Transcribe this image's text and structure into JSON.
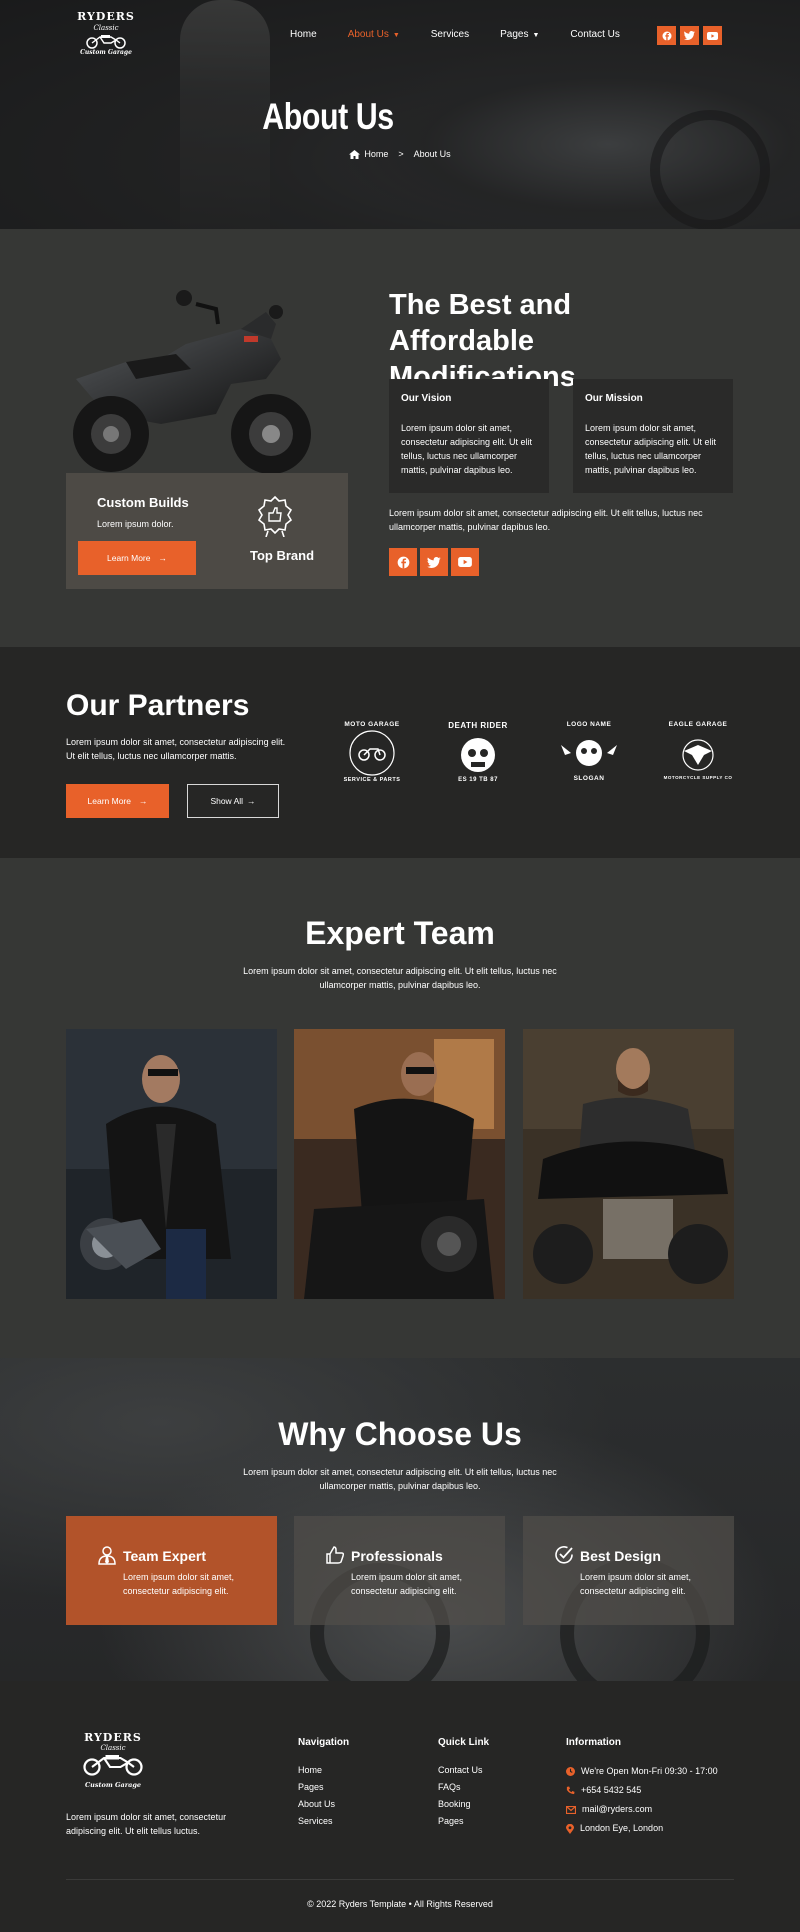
{
  "brand": {
    "name": "RYDERS",
    "sub": "Classic",
    "tag": "Custom Garage"
  },
  "nav": {
    "items": [
      {
        "label": "Home",
        "active": false,
        "caret": false
      },
      {
        "label": "About Us",
        "active": true,
        "caret": true
      },
      {
        "label": "Services",
        "active": false,
        "caret": false
      },
      {
        "label": "Pages",
        "active": false,
        "caret": true
      },
      {
        "label": "Contact Us",
        "active": false,
        "caret": false
      }
    ],
    "social": [
      "facebook-icon",
      "twitter-icon",
      "youtube-icon"
    ]
  },
  "hero": {
    "title": "About Us",
    "breadcrumb_home": "Home",
    "breadcrumb_sep": ">",
    "breadcrumb_current": "About Us"
  },
  "about": {
    "custom_builds_title": "Custom Builds",
    "custom_builds_text": "Lorem ipsum dolor.",
    "learn_more": "Learn More",
    "top_brand": "Top Brand",
    "heading": "The Best and Affordable Modifications",
    "vision_title": "Our Vision",
    "vision_text": "Lorem ipsum dolor sit amet, consectetur adipiscing elit. Ut elit tellus, luctus nec ullamcorper mattis, pulvinar dapibus leo.",
    "mission_title": "Our Mission",
    "mission_text": "Lorem ipsum dolor sit amet, consectetur adipiscing elit. Ut elit tellus, luctus nec ullamcorper mattis, pulvinar dapibus leo.",
    "paragraph": "Lorem ipsum dolor sit amet, consectetur adipiscing elit. Ut elit tellus, luctus nec ullamcorper mattis, pulvinar dapibus leo."
  },
  "partners": {
    "title": "Our Partners",
    "text": "Lorem ipsum dolor sit amet, consectetur adipiscing elit. Ut elit tellus, luctus nec ullamcorper mattis.",
    "learn_more": "Learn More",
    "show_all": "Show All",
    "logos": [
      {
        "top": "MOTO GARAGE",
        "bottom": "SERVICE & PARTS"
      },
      {
        "top": "DEATH RIDER",
        "bottom": "ES 19 TB 87"
      },
      {
        "top": "LOGO NAME",
        "bottom": "SLOGAN"
      },
      {
        "top": "EAGLE GARAGE",
        "bottom": "MOTORCYCLE SUPPLY CO"
      }
    ]
  },
  "team": {
    "title": "Expert Team",
    "lead": "Lorem ipsum dolor sit amet, consectetur adipiscing elit. Ut elit tellus, luctus nec ullamcorper mattis, pulvinar dapibus leo."
  },
  "why": {
    "title": "Why Choose Us",
    "lead": "Lorem ipsum dolor sit amet, consectetur adipiscing elit. Ut elit tellus, luctus nec ullamcorper mattis, pulvinar dapibus leo.",
    "cards": [
      {
        "title": "Team Expert",
        "text": "Lorem ipsum dolor sit amet, consectetur adipiscing elit.",
        "icon": "user-tie-icon"
      },
      {
        "title": "Professionals",
        "text": "Lorem ipsum dolor sit amet, consectetur adipiscing elit.",
        "icon": "thumbs-up-icon"
      },
      {
        "title": "Best Design",
        "text": "Lorem ipsum dolor sit amet, consectetur adipiscing elit.",
        "icon": "check-circle-icon"
      }
    ]
  },
  "footer": {
    "about": "Lorem ipsum dolor sit amet, consectetur adipiscing elit. Ut elit tellus luctus.",
    "navigation_title": "Navigation",
    "navigation": [
      "Home",
      "Pages",
      "About Us",
      "Services"
    ],
    "quick_title": "Quick Link",
    "quick": [
      "Contact Us",
      "FAQs",
      "Booking",
      "Pages"
    ],
    "info_title": "Information",
    "info": [
      {
        "icon": "clock-icon",
        "text": "We're Open Mon-Fri 09:30 - 17:00"
      },
      {
        "icon": "phone-icon",
        "text": "+654 5432 545"
      },
      {
        "icon": "mail-icon",
        "text": "mail@ryders.com"
      },
      {
        "icon": "map-pin-icon",
        "text": "London Eye, London"
      }
    ],
    "copyright": "© 2022 Ryders Template • All Rights Reserved"
  },
  "colors": {
    "accent": "#e8612a",
    "dark": "#262625",
    "mid": "#363735",
    "card": "#2a2a29",
    "tan": "#4d4a45"
  }
}
